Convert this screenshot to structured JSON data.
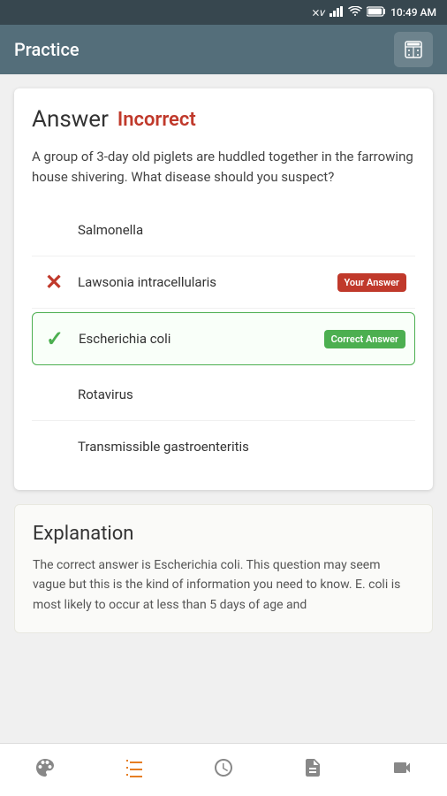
{
  "status_bar": {
    "time": "10:49 AM",
    "battery": "100",
    "icons": [
      "bluetooth",
      "signal",
      "wifi",
      "battery"
    ]
  },
  "top_bar": {
    "title": "Practice",
    "calculator_icon": "⊞"
  },
  "main": {
    "answer_label": "Answer",
    "incorrect_label": "Incorrect",
    "question": "A group of 3-day old piglets are huddled together in the farrowing house shivering. What disease should you suspect?",
    "options": [
      {
        "id": "opt1",
        "text": "Salmonella",
        "state": "none"
      },
      {
        "id": "opt2",
        "text": "Lawsonia intracellularis",
        "state": "wrong",
        "badge": "Your Answer"
      },
      {
        "id": "opt3",
        "text": "Escherichia coli",
        "state": "correct",
        "badge": "Correct Answer"
      },
      {
        "id": "opt4",
        "text": "Rotavirus",
        "state": "none"
      },
      {
        "id": "opt5",
        "text": "Transmissible gastroenteritis",
        "state": "none"
      }
    ],
    "explanation": {
      "title": "Explanation",
      "text": "The correct answer is Escherichia coli. This question may seem vague but this is the kind of information you need to know. E. coli is most likely to occur at less than 5 days of age and"
    }
  },
  "bottom_nav": {
    "items": [
      {
        "id": "palette",
        "icon": "🎨",
        "active": false
      },
      {
        "id": "list",
        "icon": "☰",
        "active": true
      },
      {
        "id": "clock",
        "icon": "🕐",
        "active": false
      },
      {
        "id": "document",
        "icon": "📄",
        "active": false
      },
      {
        "id": "video",
        "icon": "🎬",
        "active": false
      }
    ]
  }
}
